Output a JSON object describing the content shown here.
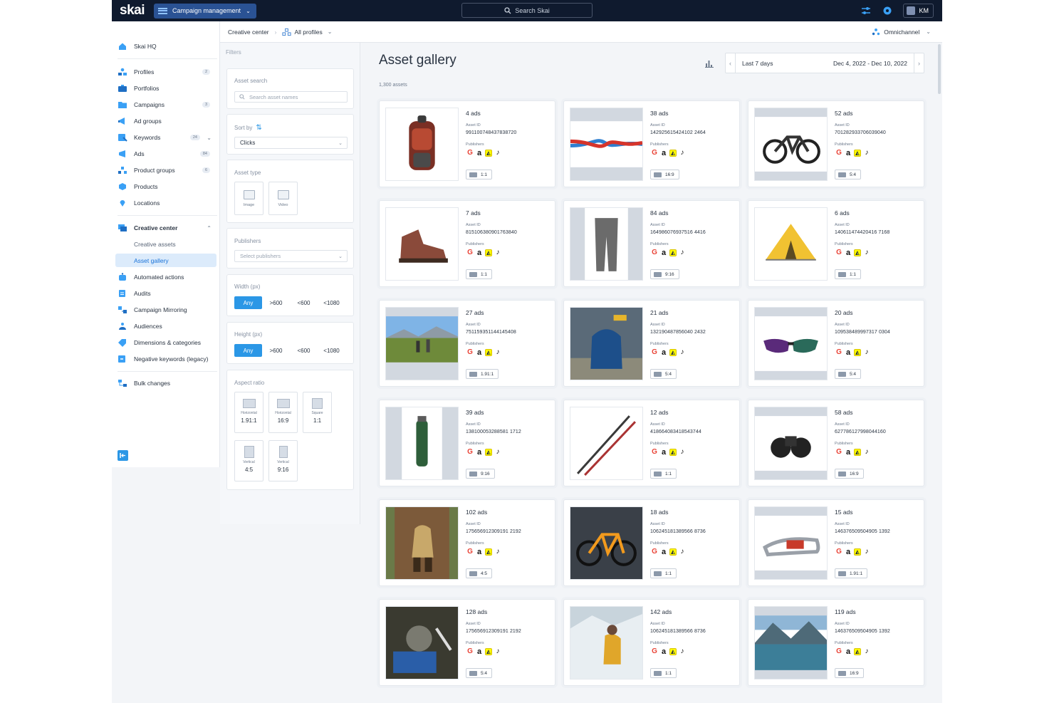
{
  "topbar": {
    "logo": "skai",
    "app_switch_label": "Campaign management",
    "search_placeholder": "Search Skai",
    "user_initials": "KM"
  },
  "nav": {
    "home": "Skai HQ",
    "items": [
      {
        "label": "Profiles",
        "badge": "2"
      },
      {
        "label": "Portfolios",
        "badge": ""
      },
      {
        "label": "Campaigns",
        "badge": "3"
      },
      {
        "label": "Ad groups",
        "badge": ""
      },
      {
        "label": "Keywords",
        "badge": "24"
      },
      {
        "label": "Ads",
        "badge": "84"
      },
      {
        "label": "Product groups",
        "badge": "6"
      },
      {
        "label": "Products",
        "badge": ""
      },
      {
        "label": "Locations",
        "badge": ""
      }
    ],
    "creative_center": "Creative center",
    "creative_assets": "Creative assets",
    "asset_gallery": "Asset gallery",
    "tools": [
      "Automated actions",
      "Audits",
      "Campaign Mirroring",
      "Audiences",
      "Dimensions & categories",
      "Negative keywords (legacy)"
    ],
    "bulk_changes": "Bulk changes"
  },
  "breadcrumb": {
    "root": "Creative center",
    "current": "All profiles",
    "right": "Omnichannel"
  },
  "filters": {
    "title": "Filters",
    "asset_search_label": "Asset search",
    "asset_search_placeholder": "Search asset names",
    "sort_label": "Sort by",
    "sort_value": "Clicks",
    "asset_type_label": "Asset type",
    "asset_types": [
      "Image",
      "Video"
    ],
    "publishers_label": "Publishers",
    "publishers_placeholder": "Select publishers",
    "width_label": "Width (px)",
    "height_label": "Height (px)",
    "size_options": [
      "Any",
      ">600",
      "<600",
      "<1080"
    ],
    "aspect_label": "Aspect ratio",
    "aspects": [
      {
        "name": "Horizontal",
        "value": "1.91:1"
      },
      {
        "name": "Horizontal",
        "value": "16:9"
      },
      {
        "name": "Square",
        "value": "1:1"
      },
      {
        "name": "Vertical",
        "value": "4:5"
      },
      {
        "name": "Vertical",
        "value": "9:16"
      }
    ]
  },
  "gallery": {
    "title": "Asset gallery",
    "count": "1,300 assets",
    "date_preset": "Last 7 days",
    "date_range": "Dec 4, 2022 - Dec 10, 2022",
    "asset_id_label": "Asset ID",
    "publishers_label": "Publishers",
    "cards": [
      {
        "ads": "4 ads",
        "id": "991100748437838720",
        "ratio": "1:1",
        "subject": "backpack"
      },
      {
        "ads": "38 ads",
        "id": "142925615424102 2464",
        "ratio": "16:9",
        "subject": "rope-knot"
      },
      {
        "ads": "52 ads",
        "id": "701282933706039040",
        "ratio": "5:4",
        "subject": "ebike"
      },
      {
        "ads": "7 ads",
        "id": "815106380901763840",
        "ratio": "1:1",
        "subject": "boot"
      },
      {
        "ads": "84 ads",
        "id": "164986076937516 4416",
        "ratio": "9:16",
        "subject": "pants"
      },
      {
        "ads": "6 ads",
        "id": "140611474420416 7168",
        "ratio": "1:1",
        "subject": "tent"
      },
      {
        "ads": "27 ads",
        "id": "751159351144145408",
        "ratio": "1.91:1",
        "subject": "hikers"
      },
      {
        "ads": "21 ads",
        "id": "132190487856040 2432",
        "ratio": "5:4",
        "subject": "pack-ground"
      },
      {
        "ads": "20 ads",
        "id": "109538489997317 0304",
        "ratio": "5:4",
        "subject": "sunglasses"
      },
      {
        "ads": "39 ads",
        "id": "138100053288581 1712",
        "ratio": "9:16",
        "subject": "thermos"
      },
      {
        "ads": "12 ads",
        "id": "418664083418543744",
        "ratio": "1:1",
        "subject": "poles"
      },
      {
        "ads": "58 ads",
        "id": "627786127998044160",
        "ratio": "16:9",
        "subject": "binoculars"
      },
      {
        "ads": "102 ads",
        "id": "175656912309191 2192",
        "ratio": "4:5",
        "subject": "hiker-sitting"
      },
      {
        "ads": "18 ads",
        "id": "106245181389566 8736",
        "ratio": "1:1",
        "subject": "bike"
      },
      {
        "ads": "15 ads",
        "id": "146376509504905 1392",
        "ratio": "1.91:1",
        "subject": "carabiner"
      },
      {
        "ads": "128 ads",
        "id": "175656912309191 2192",
        "ratio": "5:4",
        "subject": "stove"
      },
      {
        "ads": "142 ads",
        "id": "106245181389566 8736",
        "ratio": "1:1",
        "subject": "skier"
      },
      {
        "ads": "119 ads",
        "id": "146376509504905 1392",
        "ratio": "16:9",
        "subject": "lake"
      }
    ]
  },
  "colors": {
    "accent": "#2b97e6",
    "topbar": "#0f1a2e",
    "selected_nav": "#dcebfb"
  }
}
